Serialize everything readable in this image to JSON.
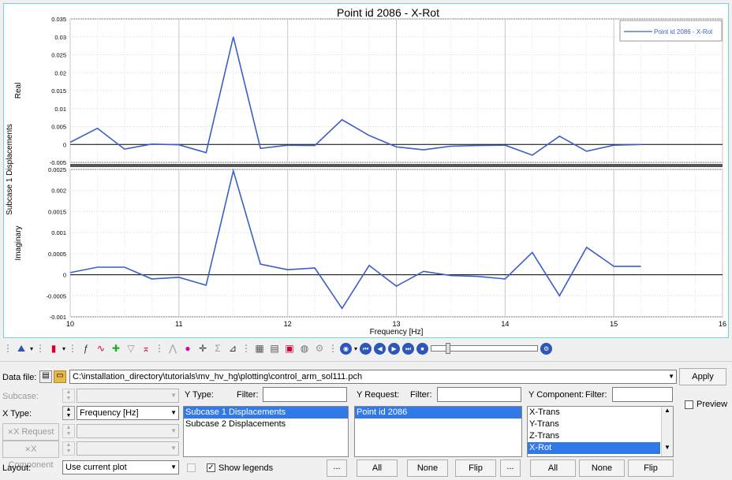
{
  "plot": {
    "title": "Point id 2086 - X-Rot",
    "ylabel_outer": "Subcase 1 Displacements",
    "legend_entry": "Point id 2086 - X-Rot",
    "colors": {
      "series": "#3a5fc8",
      "frame": "#6fd3e6"
    }
  },
  "chart_data": [
    {
      "type": "line",
      "ylabel": "Real",
      "xlabel": "",
      "xlim": [
        10,
        16
      ],
      "ylim": [
        -0.005,
        0.035
      ],
      "xticks": [
        "10",
        "11",
        "12",
        "13",
        "14",
        "15",
        "16"
      ],
      "yticks": [
        "-0.005",
        "0",
        "0.005",
        "0.01",
        "0.015",
        "0.02",
        "0.025",
        "0.03",
        "0.035"
      ],
      "grid": true,
      "legend": "top-right",
      "series": [
        {
          "name": "Point id 2086 - X-Rot",
          "x": [
            10,
            10.25,
            10.5,
            10.75,
            11,
            11.25,
            11.5,
            11.75,
            12,
            12.25,
            12.5,
            12.75,
            13,
            13.25,
            13.5,
            13.75,
            14,
            14.25,
            14.5,
            14.75,
            15,
            15.25
          ],
          "y": [
            0.0006,
            0.0045,
            -0.0013,
            0.0001,
            -0.0001,
            -0.0023,
            0.03,
            -0.0011,
            -0.0002,
            -0.0003,
            0.0069,
            0.0025,
            -0.0007,
            -0.0015,
            -0.0005,
            -0.0003,
            -0.0002,
            -0.003,
            0.0023,
            -0.0019,
            -0.0002,
            0.0
          ]
        }
      ]
    },
    {
      "type": "line",
      "ylabel": "Imaginary",
      "xlabel": "Frequency [Hz]",
      "xlim": [
        10,
        16
      ],
      "ylim": [
        -0.001,
        0.0025
      ],
      "xticks": [
        "10",
        "11",
        "12",
        "13",
        "14",
        "15",
        "16"
      ],
      "yticks": [
        "-0.001",
        "-0.0005",
        "0",
        "0.0005",
        "0.001",
        "0.0015",
        "0.002",
        "0.0025"
      ],
      "grid": true,
      "series": [
        {
          "name": "Point id 2086 - X-Rot",
          "x": [
            10,
            10.25,
            10.5,
            10.75,
            11,
            11.25,
            11.5,
            11.75,
            12,
            12.25,
            12.5,
            12.75,
            13,
            13.25,
            13.5,
            13.75,
            14,
            14.25,
            14.5,
            14.75,
            15,
            15.25
          ],
          "y": [
            5e-05,
            0.00018,
            0.00018,
            -0.0001,
            -6e-05,
            -0.00025,
            0.00247,
            0.00025,
            0.00012,
            0.00016,
            -0.0008,
            0.00022,
            -0.00027,
            8e-05,
            -2e-05,
            -4e-05,
            -0.0001,
            0.00053,
            -0.0005,
            0.00065,
            0.0002,
            0.0002
          ]
        }
      ]
    }
  ],
  "toolbar": {
    "icons": [
      "chart-type-icon",
      "bar-chart-icon",
      "curve-math-icon",
      "curve-edit-icon",
      "add-curve-icon",
      "filter-icon",
      "cut-icon",
      "peak-icon",
      "color-wheel-icon",
      "crosshair-icon",
      "sum-icon",
      "axis-icon",
      "grid-icon",
      "table-icon",
      "export-icon",
      "note-icon",
      "settings-icon"
    ],
    "playback": [
      "rewind-start",
      "step-back",
      "play",
      "step-forward",
      "end"
    ]
  },
  "form": {
    "datafile_label": "Data file:",
    "datafile_value": "C:\\installation_directory\\tutorials\\mv_hv_hg\\plotting\\control_arm_sol111.pch",
    "apply_label": "Apply",
    "subcase_label": "Subcase:",
    "xtype_label": "X Type:",
    "xtype_value": "Frequency [Hz]",
    "xrequest_label": "X Request",
    "xcomponent_label": "X Component",
    "layout_label": "Layout:",
    "layout_value": "Use current plot",
    "show_legends_label": "Show legends",
    "preview_label": "Preview",
    "ellipsis": "...",
    "ytype": {
      "label": "Y Type:",
      "filter_label": "Filter:",
      "items": [
        "Subcase 1 Displacements",
        "Subcase 2 Displacements"
      ]
    },
    "yrequest": {
      "label": "Y Request:",
      "filter_label": "Filter:",
      "items": [
        "Point id 2086"
      ],
      "all": "All",
      "none": "None",
      "flip": "Flip"
    },
    "ycomponent": {
      "label": "Y Component:",
      "filter_label": "Filter:",
      "items": [
        "X-Trans",
        "Y-Trans",
        "Z-Trans",
        "X-Rot"
      ],
      "all": "All",
      "none": "None",
      "flip": "Flip"
    }
  }
}
